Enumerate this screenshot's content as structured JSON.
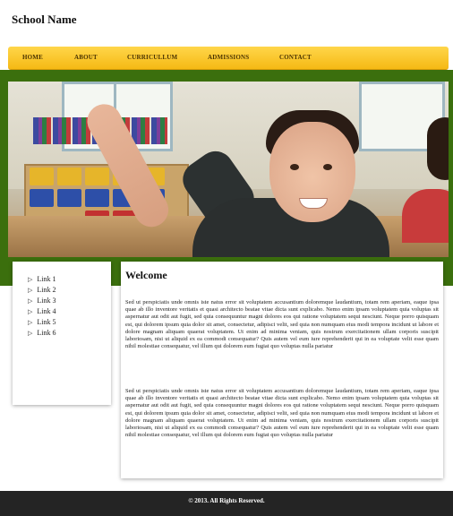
{
  "header": {
    "school_name": "School Name"
  },
  "nav": {
    "items": [
      {
        "label": "HOME"
      },
      {
        "label": "ABOUT"
      },
      {
        "label": "CURRICULLUM"
      },
      {
        "label": "ADMISSIONS"
      },
      {
        "label": "CONTACT"
      }
    ]
  },
  "hero": {
    "image": "classroom-photo-boy-raising-hand"
  },
  "sidebar": {
    "links": [
      {
        "label": "Link 1"
      },
      {
        "label": "Link 2"
      },
      {
        "label": "Link 3"
      },
      {
        "label": "Link 4"
      },
      {
        "label": "Link 5"
      },
      {
        "label": "Link 6"
      }
    ],
    "arrow_icon": "triangle-right-icon"
  },
  "main": {
    "title": "Welcome",
    "paragraphs": [
      "Sed ut perspiciatis unde omnis iste natus error sit voluptatem accusantium doloremque laudantium, totam rem aperiam, eaque ipsa quae ab illo inventore veritatis et quasi architecto beatae vitae dicta sunt explicabo. Nemo enim ipsam voluptatem quia voluptas sit aspernatur aut odit aut fugit, sed quia consequuntur magni dolores eos qui ratione voluptatem sequi nesciunt. Neque porro quisquam est, qui dolorem ipsum quia dolor sit amet, consectetur, adipisci velit, sed quia non numquam eius modi tempora incidunt ut labore et dolore magnam aliquam quaerat voluptatem. Ut enim ad minima veniam, quis nostrum exercitationem ullam corporis suscipit laboriosam, nisi ut aliquid ex ea commodi consequatur? Quis autem vel eum iure reprehenderit qui in ea voluptate velit esse quam nihil molestiae consequatur, vel illum qui dolorem eum fugiat quo voluptas nulla pariatur",
      "Sed ut perspiciatis unde omnis iste natus error sit voluptatem accusantium doloremque laudantium, totam rem aperiam, eaque ipsa quae ab illo inventore veritatis et quasi architecto beatae vitae dicta sunt explicabo. Nemo enim ipsam voluptatem quia voluptas sit aspernatur aut odit aut fugit, sed quia consequuntur magni dolores eos qui ratione voluptatem sequi nesciunt. Neque porro quisquam est, qui dolorem ipsum quia dolor sit amet, consectetur, adipisci velit, sed quia non numquam eius modi tempora incidunt ut labore et dolore magnam aliquam quaerat voluptatem. Ut enim ad minima veniam, quis nostrum exercitationem ullam corporis suscipit laboriosam, nisi ut aliquid ex ea commodi consequatur? Quis autem vel eum iure reprehenderit qui in ea voluptate velit esse quam nihil molestiae consequatur, vel illum qui dolorem eum fugiat quo voluptas nulla pariatur"
    ]
  },
  "footer": {
    "copyright": "© 2013. All Rights Reserved."
  },
  "colors": {
    "nav_gradient_top": "#ffd64a",
    "nav_gradient_bottom": "#f5b914",
    "green_band": "#3b6f0d",
    "footer_bg": "#242424"
  }
}
